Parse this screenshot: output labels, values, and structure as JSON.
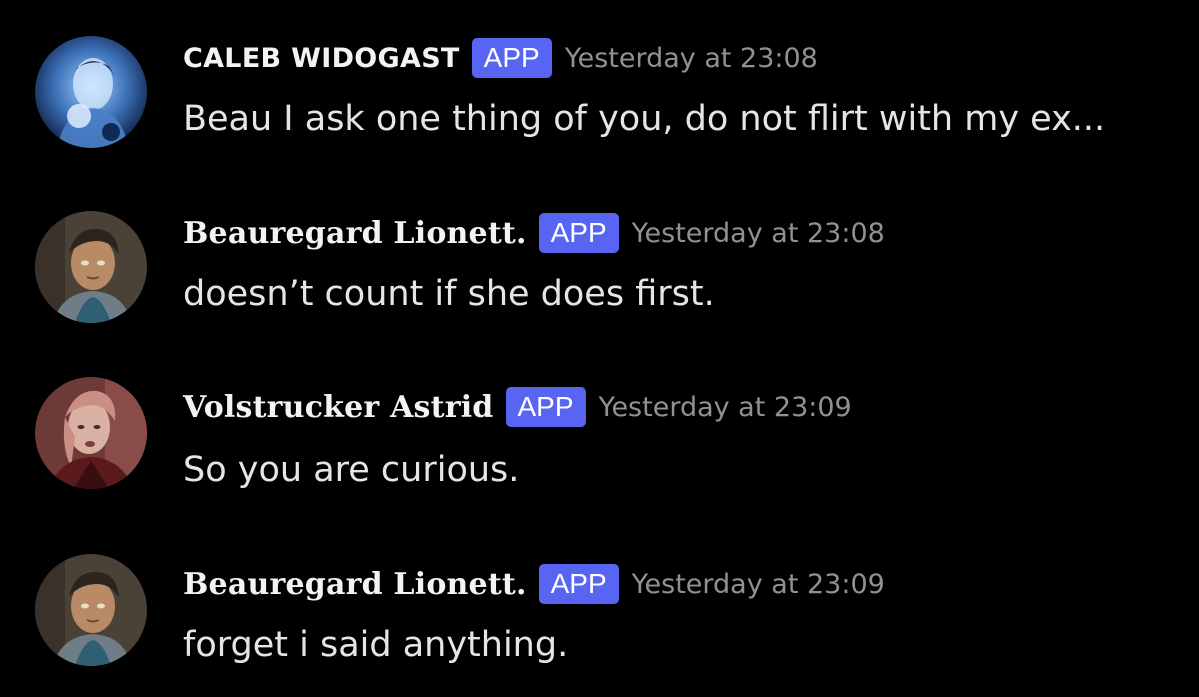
{
  "colors": {
    "background": "#000000",
    "app_badge": "#5865f2",
    "timestamp": "#8e9297",
    "text": "#e3e5e8"
  },
  "messages": [
    {
      "author": "CALEB WIDOGAST",
      "badge": "APP",
      "timestamp": "Yesterday at 23:08",
      "content": "Beau I ask one thing of you, do not flirt with my ex...",
      "avatar_icon": "caleb-avatar"
    },
    {
      "author": "Beauregard Lionett.",
      "badge": "APP",
      "timestamp": "Yesterday at 23:08",
      "content": "doesn’t count if she does first.",
      "avatar_icon": "beauregard-avatar"
    },
    {
      "author": "Volstrucker Astrid",
      "badge": "APP",
      "timestamp": "Yesterday at 23:09",
      "content": "So you are curious.",
      "avatar_icon": "astrid-avatar"
    },
    {
      "author": "Beauregard Lionett.",
      "badge": "APP",
      "timestamp": "Yesterday at 23:09",
      "content": "forget i said anything.",
      "avatar_icon": "beauregard-avatar"
    }
  ]
}
